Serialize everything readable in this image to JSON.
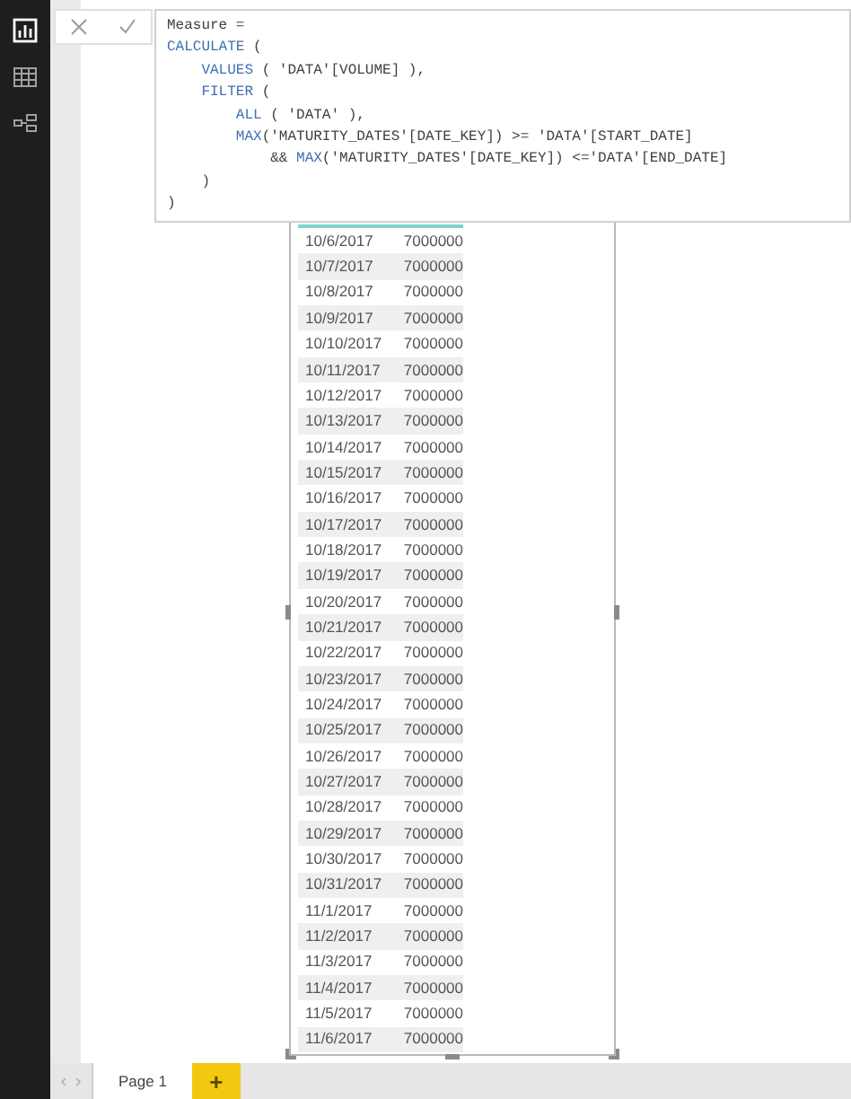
{
  "sidebar": {
    "items": [
      {
        "kind": "report",
        "selected": true
      },
      {
        "kind": "data",
        "selected": false
      },
      {
        "kind": "model",
        "selected": false
      }
    ]
  },
  "formula_bar": {
    "lines": [
      [
        {
          "kind": "text",
          "text": "Measure ="
        }
      ],
      [
        {
          "kind": "keyword",
          "text": "CALCULATE"
        },
        {
          "kind": "text",
          "text": " ("
        }
      ],
      [
        {
          "kind": "keyword",
          "text": "    VALUES"
        },
        {
          "kind": "text",
          "text": " ( 'DATA'[VOLUME] ),"
        }
      ],
      [
        {
          "kind": "keyword",
          "text": "    FILTER"
        },
        {
          "kind": "text",
          "text": " ("
        }
      ],
      [
        {
          "kind": "keyword",
          "text": "        ALL"
        },
        {
          "kind": "text",
          "text": " ( 'DATA' ),"
        }
      ],
      [
        {
          "kind": "keyword",
          "text": "        MAX"
        },
        {
          "kind": "text",
          "text": "('MATURITY_DATES'[DATE_KEY]) >= 'DATA'[START_DATE]"
        }
      ],
      [
        {
          "kind": "text",
          "text": "            && "
        },
        {
          "kind": "keyword",
          "text": "MAX"
        },
        {
          "kind": "text",
          "text": "('MATURITY_DATES'[DATE_KEY]) <='DATA'[END_DATE]"
        }
      ],
      [
        {
          "kind": "text",
          "text": "    )"
        }
      ],
      [
        {
          "kind": "text",
          "text": ")"
        }
      ]
    ]
  },
  "table": {
    "rows": [
      [
        "10/6/2017",
        "7000000"
      ],
      [
        "10/7/2017",
        "7000000"
      ],
      [
        "10/8/2017",
        "7000000"
      ],
      [
        "10/9/2017",
        "7000000"
      ],
      [
        "10/10/2017",
        "7000000"
      ],
      [
        "10/11/2017",
        "7000000"
      ],
      [
        "10/12/2017",
        "7000000"
      ],
      [
        "10/13/2017",
        "7000000"
      ],
      [
        "10/14/2017",
        "7000000"
      ],
      [
        "10/15/2017",
        "7000000"
      ],
      [
        "10/16/2017",
        "7000000"
      ],
      [
        "10/17/2017",
        "7000000"
      ],
      [
        "10/18/2017",
        "7000000"
      ],
      [
        "10/19/2017",
        "7000000"
      ],
      [
        "10/20/2017",
        "7000000"
      ],
      [
        "10/21/2017",
        "7000000"
      ],
      [
        "10/22/2017",
        "7000000"
      ],
      [
        "10/23/2017",
        "7000000"
      ],
      [
        "10/24/2017",
        "7000000"
      ],
      [
        "10/25/2017",
        "7000000"
      ],
      [
        "10/26/2017",
        "7000000"
      ],
      [
        "10/27/2017",
        "7000000"
      ],
      [
        "10/28/2017",
        "7000000"
      ],
      [
        "10/29/2017",
        "7000000"
      ],
      [
        "10/30/2017",
        "7000000"
      ],
      [
        "10/31/2017",
        "7000000"
      ],
      [
        "11/1/2017",
        "7000000"
      ],
      [
        "11/2/2017",
        "7000000"
      ],
      [
        "11/3/2017",
        "7000000"
      ],
      [
        "11/4/2017",
        "7000000"
      ],
      [
        "11/5/2017",
        "7000000"
      ],
      [
        "11/6/2017",
        "7000000"
      ]
    ]
  },
  "page_tabs": [
    {
      "label": "Page 1",
      "selected": true
    }
  ],
  "add_page": {
    "label": "+"
  }
}
